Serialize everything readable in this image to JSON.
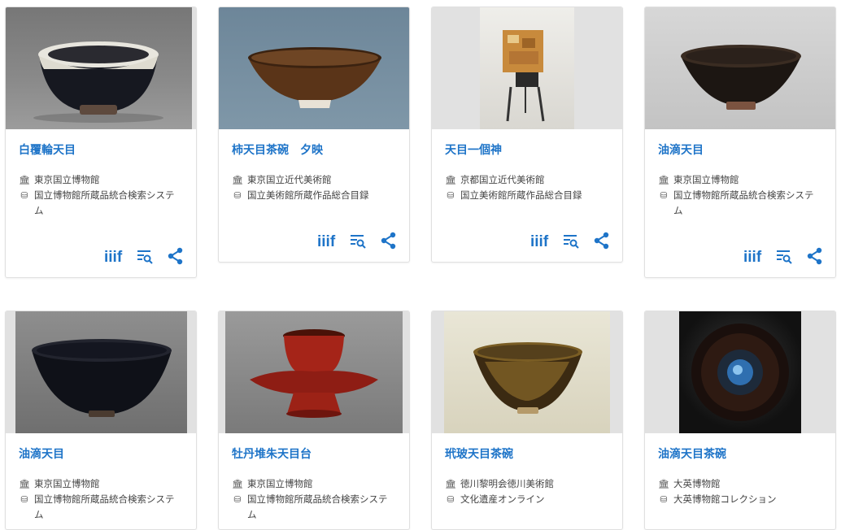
{
  "icons": {
    "institution": "museum-icon",
    "database": "database-icon",
    "iiif": "iiif-icon",
    "search": "list-search-icon",
    "share": "share-icon"
  },
  "cards": [
    {
      "title": "白覆輪天目",
      "institution": "東京国立博物館",
      "database": "国立博物館所蔵品統合検索システム"
    },
    {
      "title": "柿天目茶碗　夕映",
      "institution": "東京国立近代美術館",
      "database": "国立美術館所蔵作品総合目録"
    },
    {
      "title": "天目一個神",
      "institution": "京都国立近代美術館",
      "database": "国立美術館所蔵作品総合目録"
    },
    {
      "title": "油滴天目",
      "institution": "東京国立博物館",
      "database": "国立博物館所蔵品統合検索システム"
    },
    {
      "title": "油滴天目",
      "institution": "東京国立博物館",
      "database": "国立博物館所蔵品統合検索システム"
    },
    {
      "title": "牡丹堆朱天目台",
      "institution": "東京国立博物館",
      "database": "国立博物館所蔵品統合検索システム"
    },
    {
      "title": "玳玻天目茶碗",
      "institution": "徳川黎明会徳川美術館",
      "database": "文化遺産オンライン"
    },
    {
      "title": "油滴天目茶碗",
      "institution": "大英博物館",
      "database": "大英博物館コレクション"
    }
  ]
}
